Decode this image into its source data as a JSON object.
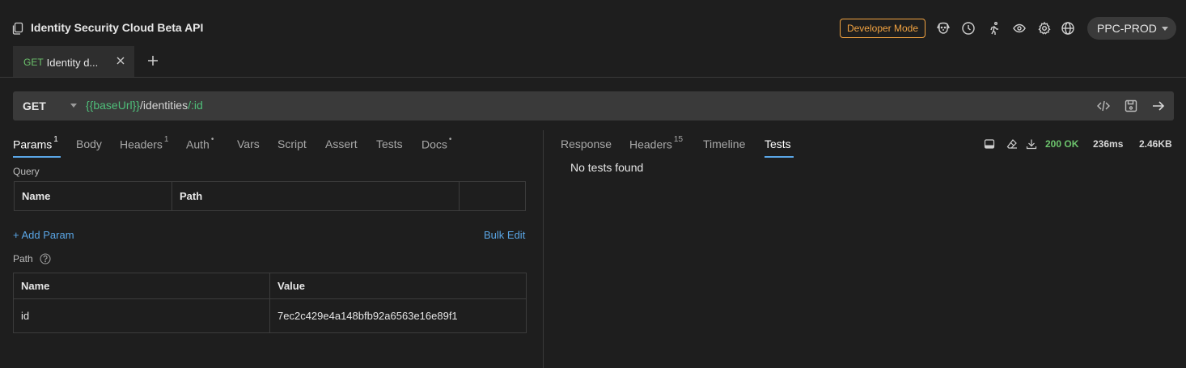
{
  "header": {
    "title": "Identity Security Cloud Beta API",
    "developer_mode": "Developer Mode",
    "environment": "PPC-PROD",
    "icons": [
      "collection-icon",
      "dog-icon",
      "history-icon",
      "runner-icon",
      "eye-icon",
      "gear-icon",
      "globe-icon"
    ]
  },
  "tabs": [
    {
      "method": "GET",
      "name": "Identity d..."
    }
  ],
  "request": {
    "method": "GET",
    "url_parts": [
      "{{baseUrl}}",
      "/identities",
      "/:id"
    ]
  },
  "left_tabs": {
    "params": "Params",
    "params_count": "1",
    "body": "Body",
    "headers": "Headers",
    "headers_count": "1",
    "auth": "Auth",
    "auth_dot": "•",
    "vars": "Vars",
    "script": "Script",
    "assert": "Assert",
    "tests": "Tests",
    "docs": "Docs",
    "docs_dot": "•"
  },
  "query": {
    "label": "Query",
    "columns": [
      "Name",
      "Path",
      ""
    ],
    "add_param": "+ Add Param",
    "bulk_edit": "Bulk Edit"
  },
  "path": {
    "label": "Path",
    "columns": [
      "Name",
      "Value"
    ],
    "rows": [
      {
        "name": "id",
        "value": "7ec2c429e4a148bfb92a6563e16e89f1"
      }
    ]
  },
  "right_tabs": {
    "response": "Response",
    "headers": "Headers",
    "headers_count": "15",
    "timeline": "Timeline",
    "tests": "Tests"
  },
  "response": {
    "status": "200 OK",
    "time": "236ms",
    "size": "2.46KB",
    "tests_message": "No tests found"
  },
  "colors": {
    "accent": "#5aa6e6",
    "success": "#6cc36c",
    "warning": "#f2a341",
    "variable": "#4fbf7a"
  }
}
